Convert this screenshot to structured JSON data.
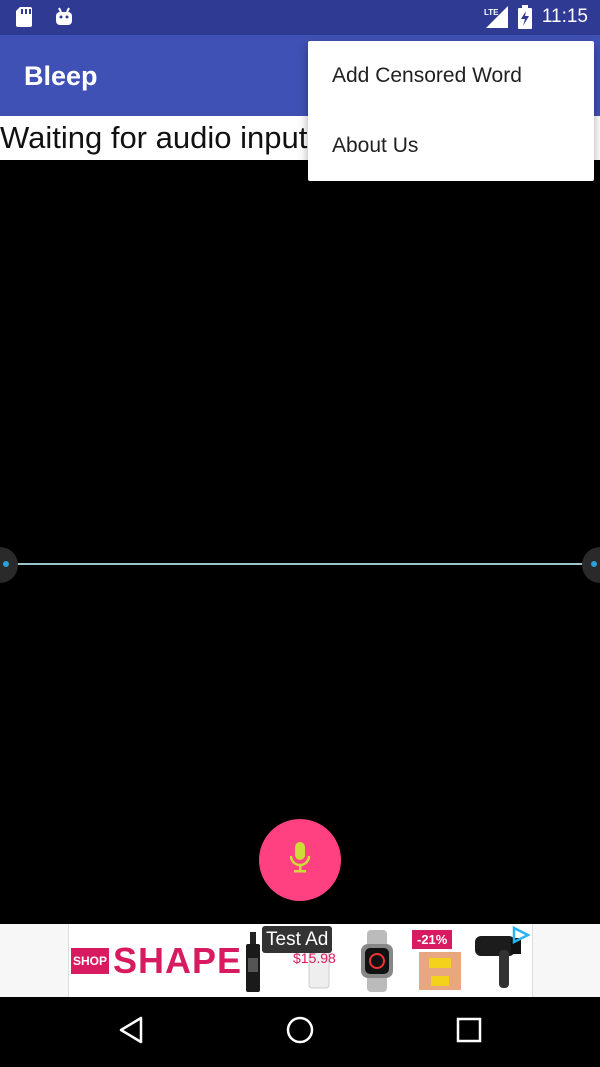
{
  "status_bar": {
    "time": "11:15",
    "icons": [
      "sd-card-icon",
      "android-icon",
      "lte-signal-icon",
      "battery-charging-icon"
    ]
  },
  "app_bar": {
    "title": "Bleep"
  },
  "main": {
    "status_text": "Waiting for audio input..."
  },
  "fab": {
    "icon": "microphone-icon",
    "color": "#ff4081"
  },
  "ad": {
    "shop_label": "SHOP",
    "brand": "SHAPE",
    "test_label": "Test Ad",
    "price": "$15.98",
    "discount": "-21%"
  },
  "overflow_menu": {
    "items": [
      {
        "label": "Add Censored Word"
      },
      {
        "label": "About Us"
      }
    ]
  },
  "nav_bar": {
    "buttons": [
      "back-icon",
      "home-icon",
      "recents-icon"
    ]
  },
  "colors": {
    "primary": "#3f51b5",
    "primary_dark": "#2f3a93",
    "accent": "#ff4081"
  }
}
